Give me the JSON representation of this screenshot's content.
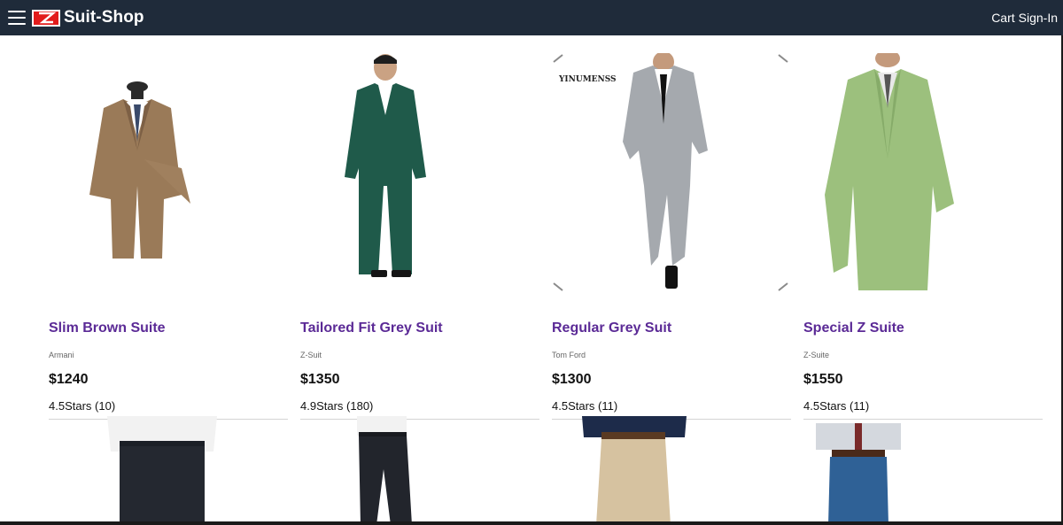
{
  "header": {
    "brand": "Suit-Shop",
    "cart_label": "Cart",
    "signin_label": "Sign-In"
  },
  "products": [
    {
      "title": "Slim Brown Suite",
      "brand": "Armani",
      "price": "$1240",
      "rating": "4.5Stars (10)"
    },
    {
      "title": "Tailored Fit Grey Suit",
      "brand": "Z-Suit",
      "price": "$1350",
      "rating": "4.9Stars (180)"
    },
    {
      "title": "Regular Grey Suit",
      "brand": "Tom Ford",
      "price": "$1300",
      "rating": "4.5Stars (11)"
    },
    {
      "title": "Special Z Suite",
      "brand": "Z-Suite",
      "price": "$1550",
      "rating": "4.5Stars (11)"
    }
  ],
  "watermark": "YINUMENSS",
  "colors": {
    "topbar": "#1f2b3a",
    "product_title": "#5b2a96",
    "logo_red": "#e21b1b"
  }
}
